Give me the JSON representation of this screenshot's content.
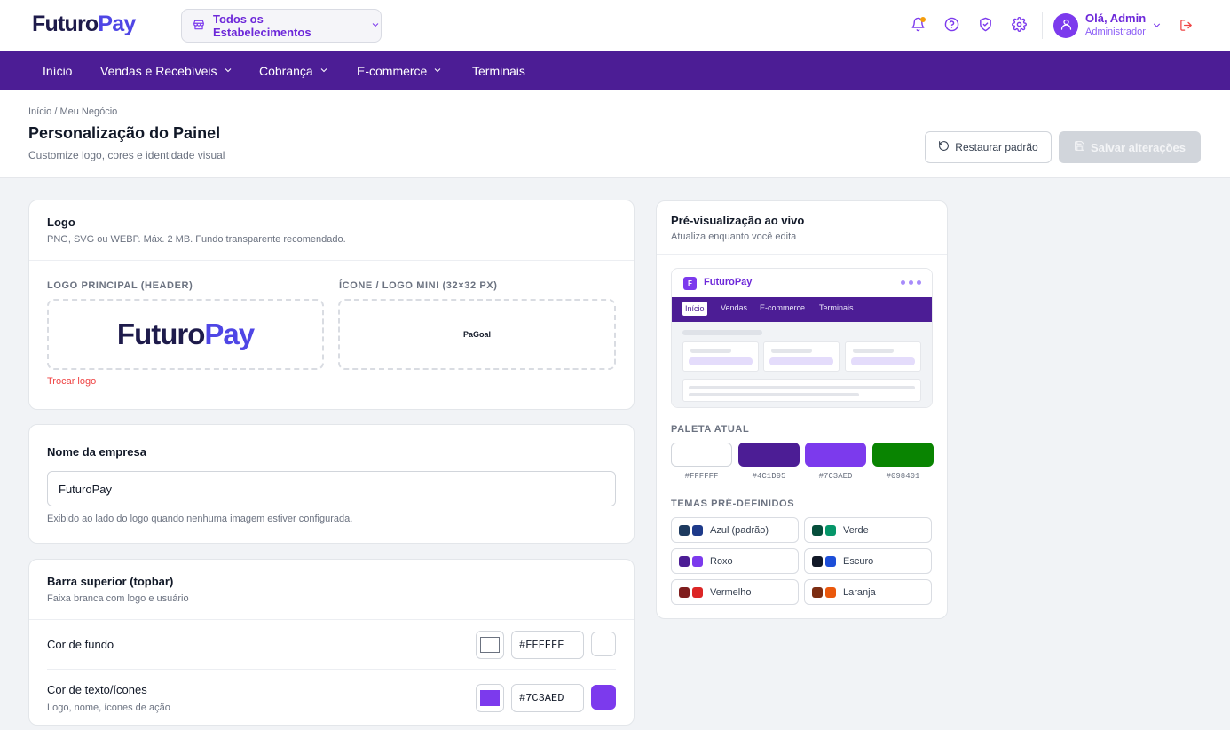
{
  "header": {
    "brand_a": "Futuro",
    "brand_b": "Pay",
    "establishment": "Todos os Estabelecimentos",
    "user_greeting": "Olá, Admin",
    "user_role": "Administrador",
    "icons": [
      "store-icon",
      "bell-icon",
      "help-icon",
      "shield-icon",
      "gear-icon",
      "user-icon",
      "chevron-down-icon",
      "logout-icon"
    ]
  },
  "nav": {
    "items": [
      {
        "label": "Início"
      },
      {
        "label": "Vendas e Recebíveis"
      },
      {
        "label": "Cobrança"
      },
      {
        "label": "E-commerce"
      },
      {
        "label": "Terminais"
      }
    ]
  },
  "page": {
    "breadcrumb": "Início / Meu Negócio",
    "title": "Personalização do Painel",
    "subtitle": "Customize logo, cores e identidade visual",
    "restore_label": "Restaurar padrão",
    "save_label": "Salvar alterações"
  },
  "logo_card": {
    "title": "Logo",
    "subtitle": "PNG, SVG ou WEBP. Máx. 2 MB. Fundo transparente recomendado.",
    "main_label": "LOGO PRINCIPAL (HEADER)",
    "mini_label": "ÍCONE / LOGO MINI (32×32 PX)",
    "main_logo_a": "Futuro",
    "main_logo_b": "Pay",
    "mini_logo": "PaGoal",
    "change_label": "Trocar logo"
  },
  "company_card": {
    "title": "Nome da empresa",
    "value": "FuturoPay",
    "help": "Exibido ao lado do logo quando nenhuma imagem estiver configurada."
  },
  "topbar_card": {
    "title": "Barra superior (topbar)",
    "subtitle": "Faixa branca com logo e usuário",
    "bg_label": "Cor de fundo",
    "bg_value": "#FFFFFF",
    "text_label": "Cor de texto/ícones",
    "text_help": "Logo, nome, ícones de ação",
    "text_value": "#7C3AED"
  },
  "preview": {
    "title": "Pré-visualização ao vivo",
    "subtitle": "Atualiza enquanto você edita",
    "logo_letter": "F",
    "name": "FuturoPay",
    "nav": [
      "Início",
      "Vendas",
      "E-commerce",
      "Terminais"
    ],
    "palette_label": "PALETA ATUAL",
    "palette": [
      {
        "hex": "#FFFFFF",
        "label": "#FFFFFF"
      },
      {
        "hex": "#4C1D95",
        "label": "#4C1D95"
      },
      {
        "hex": "#7C3AED",
        "label": "#7C3AED"
      },
      {
        "hex": "#098401",
        "label": "#098401"
      }
    ],
    "themes_label": "TEMAS PRÉ-DEFINIDOS",
    "themes": [
      {
        "label": "Azul (padrão)",
        "c1": "#1e3a5f",
        "c2": "#1e3a8a"
      },
      {
        "label": "Verde",
        "c1": "#064e3b",
        "c2": "#059669"
      },
      {
        "label": "Roxo",
        "c1": "#4c1d95",
        "c2": "#7c3aed"
      },
      {
        "label": "Escuro",
        "c1": "#111827",
        "c2": "#1d4ed8"
      },
      {
        "label": "Vermelho",
        "c1": "#7f1d1d",
        "c2": "#dc2626"
      },
      {
        "label": "Laranja",
        "c1": "#7c2d12",
        "c2": "#ea580c"
      }
    ]
  }
}
